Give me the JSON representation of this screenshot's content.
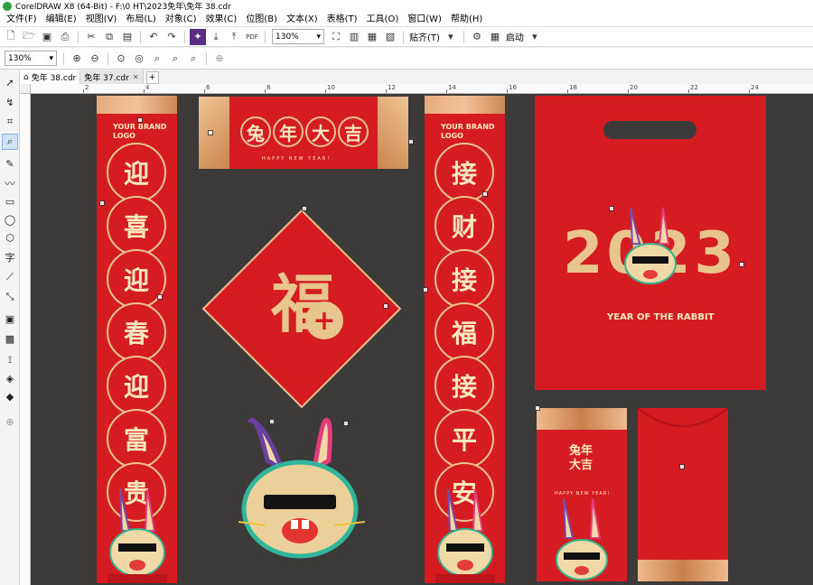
{
  "window": {
    "title": "CorelDRAW X8 (64-Bit) - F:\\0 HT\\2023免年\\免年 38.cdr"
  },
  "menu": [
    "文件(F)",
    "编辑(E)",
    "视图(V)",
    "布局(L)",
    "对象(C)",
    "效果(C)",
    "位图(B)",
    "文本(X)",
    "表格(T)",
    "工具(O)",
    "窗口(W)",
    "帮助(H)"
  ],
  "toolbar": {
    "zoom_value": "130%",
    "snap_label": "贴齐(T)",
    "launch_label": "启动"
  },
  "propbar": {
    "zoom_value": "130%"
  },
  "tabs": [
    {
      "label": "免年 38.cdr",
      "active": true
    },
    {
      "label": "免年 37.cdr",
      "active": false
    }
  ],
  "ruler": {
    "h_labels": [
      "2",
      "4",
      "6",
      "8",
      "10",
      "12",
      "14",
      "16",
      "18",
      "20",
      "22",
      "24"
    ]
  },
  "artwork": {
    "brand_line1": "YOUR BRAND",
    "brand_line2": "LOGO",
    "left_couplet": [
      "迎",
      "喜",
      "迎",
      "春",
      "迎",
      "富",
      "贵"
    ],
    "right_couplet": [
      "接",
      "财",
      "接",
      "福",
      "接",
      "平",
      "安"
    ],
    "horizontal_scroll": [
      "兔",
      "年",
      "大",
      "吉"
    ],
    "horizontal_subtitle": "HAPPY NEW YEAR!",
    "fu_character": "福",
    "year_number": "2023",
    "year_caption": "YEAR OF THE RABBIT",
    "card_title_1": "兔年",
    "card_title_2": "大吉",
    "card_subtitle": "HAPPY NEW YEAR!",
    "colors": {
      "red": "#d51c22",
      "gold": "#e7c58c",
      "dark_canvas": "#3d3a3a"
    }
  }
}
